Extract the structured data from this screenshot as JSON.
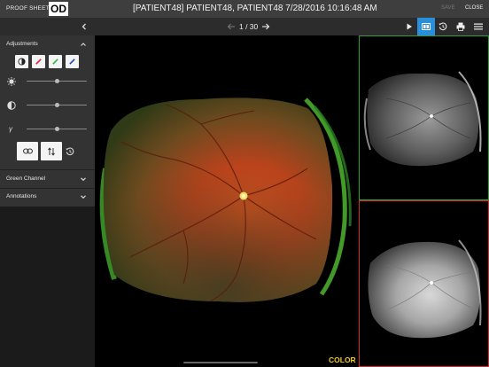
{
  "header": {
    "proof_sheet": "PROOF SHEET",
    "eye": "OD",
    "title": "[PATIENT48] PATIENT48, PATIENT48  7/28/2016 10:16:48 AM",
    "save": "SAVE",
    "close": "CLOSE"
  },
  "toolbar": {
    "pager": "1 / 30",
    "buttons": [
      "play-icon",
      "compare-icon",
      "history-icon",
      "print-icon",
      "menu-icon"
    ],
    "active_button": "compare-icon"
  },
  "sidebar": {
    "adjustments": {
      "label": "Adjustments",
      "channels": [
        "contrast",
        "red",
        "green",
        "blue"
      ],
      "sliders": [
        {
          "name": "brightness",
          "value": 0.5
        },
        {
          "name": "contrast",
          "value": 0.5
        },
        {
          "name": "gamma",
          "label": "γ",
          "value": 0.5
        }
      ]
    },
    "green_channel": {
      "label": "Green Channel"
    },
    "annotations": {
      "label": "Annotations"
    }
  },
  "main": {
    "image_label": "COLOR"
  },
  "colors": {
    "accent": "#2a8fd9",
    "green_frame": "#2ea02e",
    "red_frame": "#d32a2a",
    "label": "#f2c81b"
  }
}
